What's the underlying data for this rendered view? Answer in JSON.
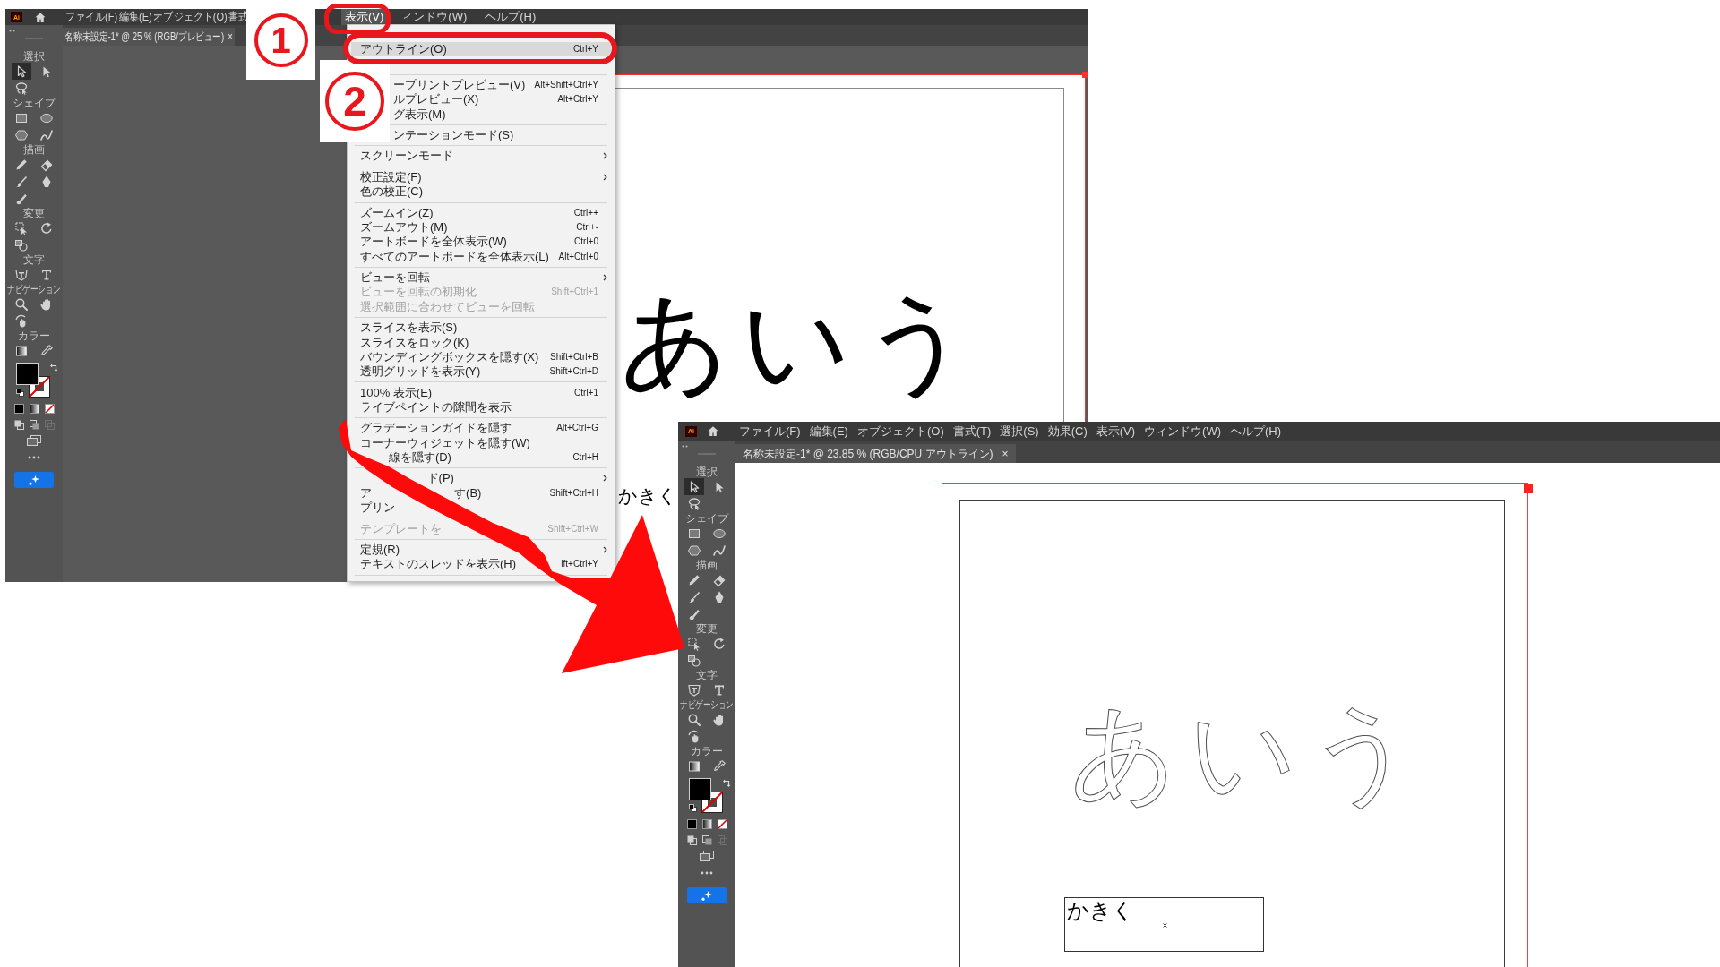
{
  "screenshots": [
    {
      "app_logo": "Ai",
      "menus": [
        {
          "label": "ファイル(F)",
          "selected": false
        },
        {
          "label": "編集(E)",
          "selected": false
        },
        {
          "label": "オブジェクト(O)",
          "selected": false
        },
        {
          "label": "書式",
          "selected": false
        }
      ],
      "menus_after_gap": [
        {
          "label": "表示(V)",
          "selected": true
        },
        {
          "label": "ィンドウ(W)",
          "selected": false
        },
        {
          "label": "ヘルプ(H)",
          "selected": false
        }
      ],
      "tab": {
        "title": "名称未設定-1* @ 25 % (RGB/プレビュー)",
        "close": "×",
        "selected": true
      },
      "toolbar": {
        "groups": [
          {
            "label": "選択",
            "tools": [
              {
                "kind": "selection",
                "selected": true
              },
              {
                "kind": "direct_selection",
                "selected": false
              },
              {
                "kind": "lasso",
                "selected": false
              }
            ]
          },
          {
            "label": "シェイプ",
            "tools": [
              {
                "kind": "rectangle",
                "selected": false
              },
              {
                "kind": "ellipse",
                "selected": false
              },
              {
                "kind": "polygon",
                "selected": false
              },
              {
                "kind": "shaper",
                "selected": false
              }
            ]
          },
          {
            "label": "描画",
            "tools": [
              {
                "kind": "pencil",
                "selected": false
              },
              {
                "kind": "eraser",
                "selected": false
              },
              {
                "kind": "paintbrush",
                "selected": false
              },
              {
                "kind": "pen",
                "selected": false
              },
              {
                "kind": "blob_brush",
                "selected": false
              }
            ]
          },
          {
            "label": "変更",
            "tools": [
              {
                "kind": "free_transform",
                "selected": false
              },
              {
                "kind": "rotate",
                "selected": false
              },
              {
                "kind": "shape_builder",
                "selected": false
              }
            ]
          },
          {
            "label": "文字",
            "tools": [
              {
                "kind": "touch_type",
                "selected": false
              },
              {
                "kind": "type",
                "selected": false
              }
            ]
          },
          {
            "label": "ナビゲーション",
            "tools": [
              {
                "kind": "zoom",
                "selected": false
              },
              {
                "kind": "hand",
                "selected": false
              },
              {
                "kind": "rotate_view",
                "selected": false
              }
            ]
          },
          {
            "label": "カラー",
            "tools": [
              {
                "kind": "gradient",
                "selected": false
              },
              {
                "kind": "eyedropper",
                "selected": false
              }
            ]
          }
        ]
      },
      "canvas_texts": [
        {
          "text": "あいう",
          "kind": "plain"
        },
        {
          "text": "かきく",
          "kind": "plain"
        }
      ]
    },
    {
      "app_logo": "Ai",
      "menus": [
        {
          "label": "ファイル(F)",
          "selected": false
        },
        {
          "label": "編集(E)",
          "selected": false
        },
        {
          "label": "オブジェクト(O)",
          "selected": false
        },
        {
          "label": "書式(T)",
          "selected": false
        },
        {
          "label": "選択(S)",
          "selected": false
        },
        {
          "label": "効果(C)",
          "selected": false
        },
        {
          "label": "表示(V)",
          "selected": false
        },
        {
          "label": "ウィンドウ(W)",
          "selected": false
        },
        {
          "label": "ヘルプ(H)",
          "selected": false
        }
      ],
      "tab": {
        "title": "名称未設定-1* @ 23.85 % (RGB/CPU アウトライン)",
        "close": "×",
        "selected": true
      },
      "toolbar": {
        "groups": [
          {
            "label": "選択",
            "tools": [
              {
                "kind": "selection",
                "selected": true
              },
              {
                "kind": "direct_selection",
                "selected": false
              },
              {
                "kind": "lasso",
                "selected": false
              }
            ]
          },
          {
            "label": "シェイプ",
            "tools": [
              {
                "kind": "rectangle",
                "selected": false
              },
              {
                "kind": "ellipse",
                "selected": false
              },
              {
                "kind": "polygon",
                "selected": false
              },
              {
                "kind": "shaper",
                "selected": false
              }
            ]
          },
          {
            "label": "描画",
            "tools": [
              {
                "kind": "pencil",
                "selected": false
              },
              {
                "kind": "eraser",
                "selected": false
              },
              {
                "kind": "paintbrush",
                "selected": false
              },
              {
                "kind": "pen",
                "selected": false
              },
              {
                "kind": "blob_brush",
                "selected": false
              }
            ]
          },
          {
            "label": "変更",
            "tools": [
              {
                "kind": "free_transform",
                "selected": false
              },
              {
                "kind": "rotate",
                "selected": false
              },
              {
                "kind": "shape_builder",
                "selected": false
              }
            ]
          },
          {
            "label": "文字",
            "tools": [
              {
                "kind": "touch_type",
                "selected": false
              },
              {
                "kind": "type",
                "selected": false
              }
            ]
          },
          {
            "label": "ナビゲーション",
            "tools": [
              {
                "kind": "zoom",
                "selected": false
              },
              {
                "kind": "hand",
                "selected": false
              },
              {
                "kind": "rotate_view",
                "selected": false
              }
            ]
          },
          {
            "label": "カラー",
            "tools": [
              {
                "kind": "gradient",
                "selected": false
              },
              {
                "kind": "eyedropper",
                "selected": false
              }
            ]
          }
        ]
      },
      "canvas_texts": [
        {
          "text": "あいう",
          "kind": "outline"
        },
        {
          "text": "かきく",
          "kind": "framed"
        }
      ]
    }
  ],
  "view_menu": {
    "entries": [
      {
        "kind": "item",
        "label": "アウトライン(O)",
        "shortcut": "Ctrl+Y",
        "start_covered": false,
        "selected": true,
        "disabled": false
      },
      {
        "kind": "blank"
      },
      {
        "kind": "separator"
      },
      {
        "kind": "item",
        "label": "ープリントプレビュー(V)",
        "shortcut": "Alt+Shift+Ctrl+Y",
        "start_covered": true,
        "selected": false,
        "disabled": false
      },
      {
        "kind": "item",
        "label": "ルプレビュー(X)",
        "shortcut": "Alt+Ctrl+Y",
        "start_covered": true,
        "selected": false,
        "disabled": false
      },
      {
        "kind": "item",
        "label": "グ表示(M)",
        "start_covered": true,
        "selected": false,
        "disabled": false
      },
      {
        "kind": "separator"
      },
      {
        "kind": "item",
        "label": "ンテーションモード(S)",
        "start_covered": true,
        "selected": false,
        "disabled": false
      },
      {
        "kind": "separator"
      },
      {
        "kind": "submenu",
        "label": "スクリーンモード",
        "start_covered": false,
        "selected": false,
        "disabled": false
      },
      {
        "kind": "separator"
      },
      {
        "kind": "submenu",
        "label": "校正設定(F)",
        "start_covered": false,
        "selected": false,
        "disabled": false
      },
      {
        "kind": "item",
        "label": "色の校正(C)",
        "start_covered": false,
        "selected": false,
        "disabled": false
      },
      {
        "kind": "separator"
      },
      {
        "kind": "item",
        "label": "ズームイン(Z)",
        "shortcut": "Ctrl++",
        "start_covered": false,
        "selected": false,
        "disabled": false
      },
      {
        "kind": "item",
        "label": "ズームアウト(M)",
        "shortcut": "Ctrl+-",
        "start_covered": false,
        "selected": false,
        "disabled": false
      },
      {
        "kind": "item",
        "label": "アートボードを全体表示(W)",
        "shortcut": "Ctrl+0",
        "start_covered": false,
        "selected": false,
        "disabled": false
      },
      {
        "kind": "item",
        "label": "すべてのアートボードを全体表示(L)",
        "shortcut": "Alt+Ctrl+0",
        "start_covered": false,
        "selected": false,
        "disabled": false
      },
      {
        "kind": "separator"
      },
      {
        "kind": "submenu",
        "label": "ビューを回転",
        "start_covered": false,
        "selected": false,
        "disabled": false
      },
      {
        "kind": "item",
        "label": "ビューを回転の初期化",
        "shortcut": "Shift+Ctrl+1",
        "start_covered": false,
        "selected": false,
        "disabled": true
      },
      {
        "kind": "item",
        "label": "選択範囲に合わせてビューを回転",
        "start_covered": false,
        "selected": false,
        "disabled": true
      },
      {
        "kind": "separator"
      },
      {
        "kind": "item",
        "label": "スライスを表示(S)",
        "start_covered": false,
        "selected": false,
        "disabled": false
      },
      {
        "kind": "item",
        "label": "スライスをロック(K)",
        "start_covered": false,
        "selected": false,
        "disabled": false
      },
      {
        "kind": "item",
        "label": "バウンディングボックスを隠す(X)",
        "shortcut": "Shift+Ctrl+B",
        "start_covered": false,
        "selected": false,
        "disabled": false
      },
      {
        "kind": "item",
        "label": "透明グリッドを表示(Y)",
        "shortcut": "Shift+Ctrl+D",
        "start_covered": false,
        "selected": false,
        "disabled": false
      },
      {
        "kind": "separator"
      },
      {
        "kind": "item",
        "label": "100% 表示(E)",
        "shortcut": "Ctrl+1",
        "start_covered": false,
        "selected": false,
        "disabled": false
      },
      {
        "kind": "item",
        "label": "ライブペイントの隙間を表示",
        "start_covered": false,
        "selected": false,
        "disabled": false
      },
      {
        "kind": "separator"
      },
      {
        "kind": "item",
        "label": "グラデーションガイドを隠す",
        "shortcut": "Alt+Ctrl+G",
        "start_covered": false,
        "selected": false,
        "disabled": false
      },
      {
        "kind": "item",
        "label": "コーナーウィジェットを隠す(W)",
        "start_covered": false,
        "selected": false,
        "disabled": false
      },
      {
        "kind": "item",
        "label": "線を隠す(D)",
        "shortcut": "Ctrl+H",
        "start_covered": true,
        "selected": false,
        "disabled": false
      },
      {
        "kind": "separator"
      },
      {
        "kind": "submenu",
        "label": "ド(P)",
        "start_covered": true,
        "selected": false,
        "disabled": false
      },
      {
        "kind": "item",
        "label": "ア",
        "label_after_arrow": "す(B)",
        "shortcut": "Shift+Ctrl+H",
        "start_covered": false,
        "selected": false,
        "disabled": false
      },
      {
        "kind": "item",
        "label": "プリン",
        "start_covered": false,
        "selected": false,
        "disabled": false
      },
      {
        "kind": "separator"
      },
      {
        "kind": "item",
        "label": "テンプレートを",
        "shortcut": "Shift+Ctrl+W",
        "start_covered": false,
        "selected": false,
        "disabled": true
      },
      {
        "kind": "separator"
      },
      {
        "kind": "submenu",
        "label": "定規(R)",
        "start_covered": false,
        "selected": false,
        "disabled": false
      },
      {
        "kind": "item",
        "label": "テキストのスレッドを表示(H)",
        "shortcut": "ift+Ctrl+Y",
        "start_covered": false,
        "selected": false,
        "disabled": false
      },
      {
        "kind": "separator"
      }
    ]
  },
  "step_markers": [
    {
      "label": "1"
    },
    {
      "label": "2"
    }
  ]
}
